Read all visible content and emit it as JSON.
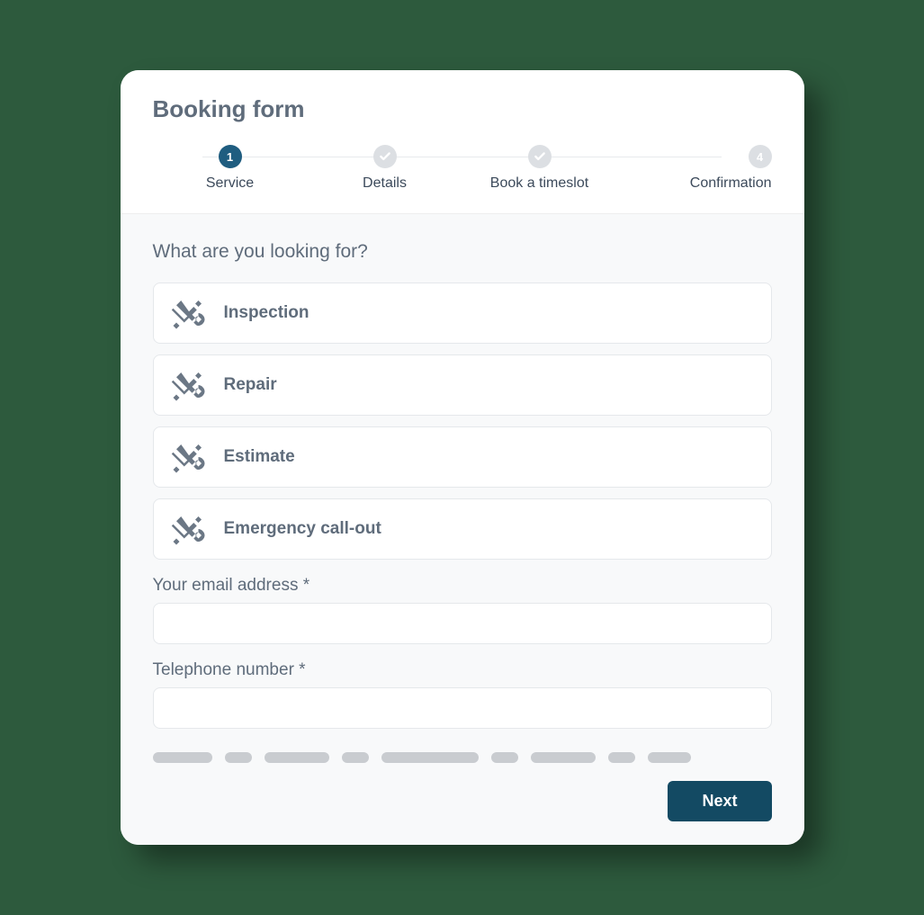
{
  "title": "Booking form",
  "colors": {
    "accent": "#1f5d80",
    "button": "#134a63",
    "muted": "#5f6c7b",
    "inactive_step": "#dcdfe3"
  },
  "stepper": {
    "steps": [
      {
        "label": "Service",
        "indicator": "1",
        "state": "active"
      },
      {
        "label": "Details",
        "indicator": "check",
        "state": "inactive"
      },
      {
        "label": "Book a timeslot",
        "indicator": "check",
        "state": "inactive"
      },
      {
        "label": "Confirmation",
        "indicator": "4",
        "state": "inactive"
      }
    ]
  },
  "body": {
    "prompt": "What are you looking for?",
    "options": [
      {
        "icon": "tools-icon",
        "label": "Inspection"
      },
      {
        "icon": "tools-icon",
        "label": "Repair"
      },
      {
        "icon": "tools-icon",
        "label": "Estimate"
      },
      {
        "icon": "tools-icon",
        "label": "Emergency call-out"
      }
    ],
    "fields": {
      "email": {
        "label": "Your email address *",
        "value": ""
      },
      "telephone": {
        "label": "Telephone number *",
        "value": ""
      }
    },
    "placeholder_bars": [
      66,
      30,
      72,
      30,
      108,
      30,
      72,
      30,
      48
    ]
  },
  "footer": {
    "next_label": "Next"
  }
}
